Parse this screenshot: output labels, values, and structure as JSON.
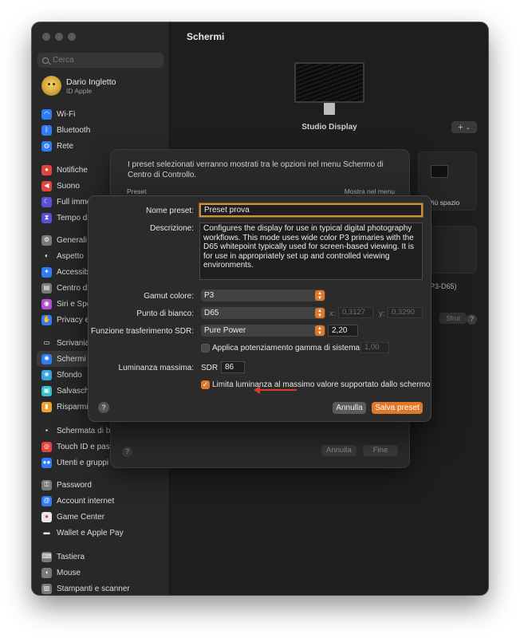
{
  "sidebar": {
    "search_placeholder": "Cerca",
    "user": {
      "name": "Dario Ingletto",
      "subtitle": "ID Apple"
    },
    "groups": [
      [
        {
          "label": "Wi-Fi",
          "icon": "wifi-icon",
          "color": "#2f7cf6",
          "glyph": "◠"
        },
        {
          "label": "Bluetooth",
          "icon": "bluetooth-icon",
          "color": "#2f7cf6",
          "glyph": "ᛒ"
        },
        {
          "label": "Rete",
          "icon": "globe-icon",
          "color": "#2f7cf6",
          "glyph": "◍"
        }
      ],
      [
        {
          "label": "Notifiche",
          "icon": "bell-icon",
          "color": "#e2453c",
          "glyph": "●"
        },
        {
          "label": "Suono",
          "icon": "speaker-icon",
          "color": "#e2453c",
          "glyph": "◀"
        },
        {
          "label": "Full imme",
          "icon": "moon-icon",
          "color": "#5b4fd6",
          "glyph": "☾"
        },
        {
          "label": "Tempo di",
          "icon": "hourglass-icon",
          "color": "#5b4fd6",
          "glyph": "⧗"
        }
      ],
      [
        {
          "label": "Generali",
          "icon": "gear-icon",
          "color": "#7a7a7a",
          "glyph": "⚙"
        },
        {
          "label": "Aspetto",
          "icon": "appearance-icon",
          "color": "#2a2a2a",
          "glyph": "◐"
        },
        {
          "label": "Accessibi",
          "icon": "accessibility-icon",
          "color": "#2f7cf6",
          "glyph": "✦"
        },
        {
          "label": "Centro di",
          "icon": "control-center-icon",
          "color": "#7a7a7a",
          "glyph": "▤"
        },
        {
          "label": "Siri e Spo",
          "icon": "siri-icon",
          "color": "#b44fd0",
          "glyph": "◉"
        },
        {
          "label": "Privacy e",
          "icon": "hand-icon",
          "color": "#2f7cf6",
          "glyph": "✋"
        }
      ],
      [
        {
          "label": "Scrivania",
          "icon": "desktop-icon",
          "color": "#2a2a2a",
          "glyph": "▭"
        },
        {
          "label": "Schermi",
          "icon": "display-icon",
          "color": "#2f7cf6",
          "glyph": "✺",
          "active": true
        },
        {
          "label": "Sfondo",
          "icon": "wallpaper-icon",
          "color": "#34a7e0",
          "glyph": "❀"
        },
        {
          "label": "Salvasche",
          "icon": "screensaver-icon",
          "color": "#34c0c8",
          "glyph": "▣"
        },
        {
          "label": "Risparmio",
          "icon": "battery-icon",
          "color": "#f0a030",
          "glyph": "▮"
        }
      ],
      [
        {
          "label": "Schermata di blo",
          "icon": "lock-icon",
          "color": "#2a2a2a",
          "glyph": "▪"
        },
        {
          "label": "Touch ID e passw",
          "icon": "fingerprint-icon",
          "color": "#e2453c",
          "glyph": "◎"
        },
        {
          "label": "Utenti e gruppi",
          "icon": "users-icon",
          "color": "#2f7cf6",
          "glyph": "●●"
        }
      ],
      [
        {
          "label": "Password",
          "icon": "key-icon",
          "color": "#7a7a7a",
          "glyph": "⚿"
        },
        {
          "label": "Account internet",
          "icon": "at-icon",
          "color": "#2f7cf6",
          "glyph": "@"
        },
        {
          "label": "Game Center",
          "icon": "game-center-icon",
          "color": "#e8e8e8",
          "glyph": "●"
        },
        {
          "label": "Wallet e Apple Pay",
          "icon": "wallet-icon",
          "color": "#2a2a2a",
          "glyph": "▬"
        }
      ],
      [
        {
          "label": "Tastiera",
          "icon": "keyboard-icon",
          "color": "#7a7a7a",
          "glyph": "⌨"
        },
        {
          "label": "Mouse",
          "icon": "mouse-icon",
          "color": "#7a7a7a",
          "glyph": "◖"
        },
        {
          "label": "Stampanti e scanner",
          "icon": "printer-icon",
          "color": "#7a7a7a",
          "glyph": "▥"
        }
      ]
    ]
  },
  "main": {
    "title": "Schermi",
    "display_name": "Studio Display",
    "add_button": "+",
    "bg_card_label": "Più spazio",
    "bg_partial_preset": "P3-D65)",
    "bg_partial_button": "Sfrut",
    "bg_help": "?"
  },
  "sheet1": {
    "description": "I preset selezionati verranno mostrati tra le opzioni nel menu Schermo di Centro di Controllo.",
    "col_preset": "Preset",
    "col_show": "Mostra nel menu",
    "help": "?",
    "cancel": "Annulla",
    "done": "Fine"
  },
  "sheet2": {
    "name_label": "Nome preset:",
    "name_value": "Preset prova",
    "desc_label": "Descrizione:",
    "desc_value": "Configures the display for use in typical digital photography workflows. This mode uses wide color P3 primaries with the D65 whitepoint typically used for screen-based viewing. It is for use in appropriately set up and controlled viewing environments.",
    "gamut_label": "Gamut colore:",
    "gamut_value": "P3",
    "white_label": "Punto di bianco:",
    "white_value": "D65",
    "x_label": "x:",
    "x_value": "0,3127",
    "y_label": "y:",
    "y_value": "0,3290",
    "sdr_label": "Funzione trasferimento SDR:",
    "sdr_value": "Pure Power",
    "gamma_value": "2,20",
    "boost_label": "Applica potenziamento gamma di sistema",
    "boost_value": "1,00",
    "boost_checked": false,
    "lum_label": "Luminanza massima:",
    "lum_prefix": "SDR",
    "lum_value": "86",
    "limit_label": "Limita luminanza al massimo valore supportato dallo schermo",
    "limit_checked": true,
    "help": "?",
    "cancel": "Annulla",
    "save": "Salva preset",
    "accent_color": "#e0782a",
    "annotation_arrow_color": "#d93a2b"
  }
}
